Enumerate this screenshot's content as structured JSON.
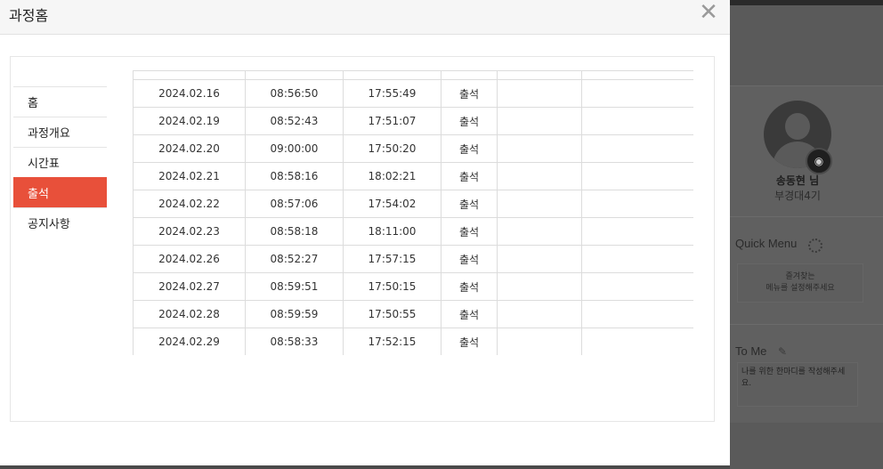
{
  "modal": {
    "title": "과정홈",
    "close_icon": "close-icon"
  },
  "sidebar": {
    "items": [
      {
        "label": "홈",
        "active": false
      },
      {
        "label": "과정개요",
        "active": false
      },
      {
        "label": "시간표",
        "active": false
      },
      {
        "label": "출석",
        "active": true
      },
      {
        "label": "공지사항",
        "active": false
      }
    ],
    "active_color": "#e8503a"
  },
  "attendance": {
    "rows": [
      {
        "date": "2024.02.16",
        "in": "08:56:50",
        "out": "17:55:49",
        "status": "출석"
      },
      {
        "date": "2024.02.19",
        "in": "08:52:43",
        "out": "17:51:07",
        "status": "출석"
      },
      {
        "date": "2024.02.20",
        "in": "09:00:00",
        "out": "17:50:20",
        "status": "출석"
      },
      {
        "date": "2024.02.21",
        "in": "08:58:16",
        "out": "18:02:21",
        "status": "출석"
      },
      {
        "date": "2024.02.22",
        "in": "08:57:06",
        "out": "17:54:02",
        "status": "출석"
      },
      {
        "date": "2024.02.23",
        "in": "08:58:18",
        "out": "18:11:00",
        "status": "출석"
      },
      {
        "date": "2024.02.26",
        "in": "08:52:27",
        "out": "17:57:15",
        "status": "출석"
      },
      {
        "date": "2024.02.27",
        "in": "08:59:51",
        "out": "17:50:15",
        "status": "출석"
      },
      {
        "date": "2024.02.28",
        "in": "08:59:59",
        "out": "17:50:55",
        "status": "출석"
      },
      {
        "date": "2024.02.29",
        "in": "08:58:33",
        "out": "17:52:15",
        "status": "출석"
      }
    ]
  },
  "background_page": {
    "user_name": "송동현 님",
    "user_team": "부경대4기",
    "quick_menu_title": "Quick Menu",
    "quick_menu_line1": "즐겨찾는",
    "quick_menu_line2": "메뉴를 설정해주세요",
    "to_me_title": "To Me",
    "to_me_text": "나를 위한 한마디를 작성해주세요.",
    "camera_icon": "camera-icon",
    "gear_icon": "gear-icon",
    "pencil_icon": "pencil-icon"
  }
}
